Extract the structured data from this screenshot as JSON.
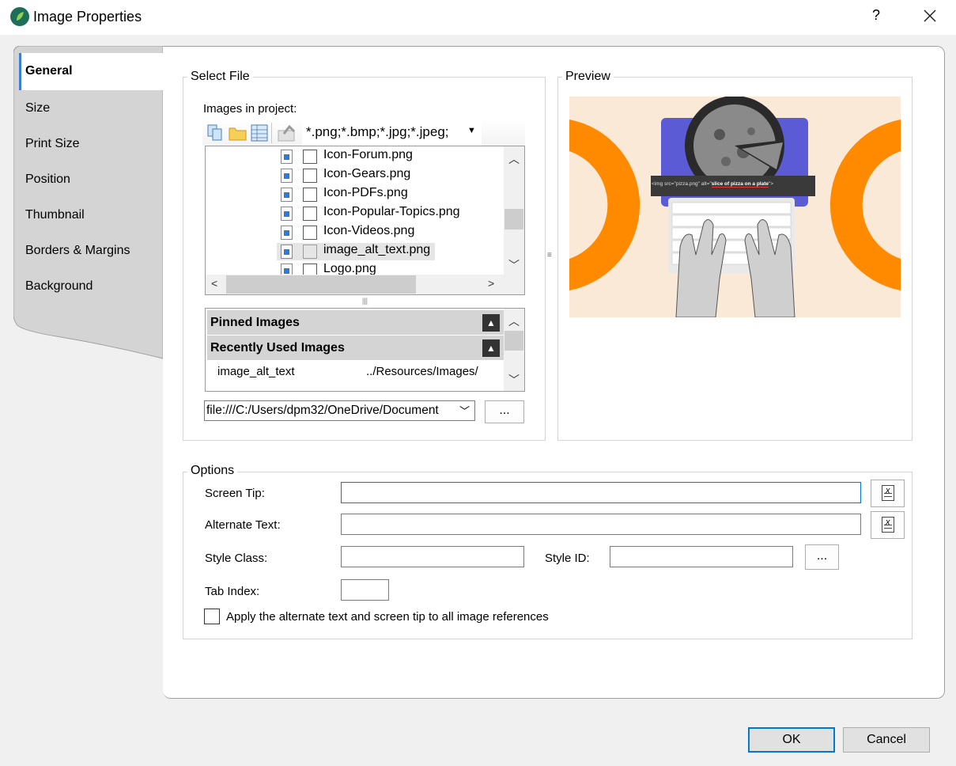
{
  "window": {
    "title": "Image Properties",
    "help": "?"
  },
  "tabs": [
    {
      "label": "General",
      "active": true
    },
    {
      "label": "Size"
    },
    {
      "label": "Print Size"
    },
    {
      "label": "Position"
    },
    {
      "label": "Thumbnail"
    },
    {
      "label": "Borders & Margins"
    },
    {
      "label": "Background"
    }
  ],
  "select_file": {
    "legend": "Select File",
    "images_label": "Images in project:",
    "filter": "*.png;*.bmp;*.jpg;*.jpeg;",
    "tree_items": [
      {
        "name": "Icon-Forum.png"
      },
      {
        "name": "Icon-Gears.png"
      },
      {
        "name": "Icon-PDFs.png"
      },
      {
        "name": "Icon-Popular-Topics.png"
      },
      {
        "name": "Icon-Videos.png"
      },
      {
        "name": "image_alt_text.png",
        "selected": true
      },
      {
        "name": "Logo.png"
      }
    ],
    "pinned_header": "Pinned Images",
    "recent_header": "Recently Used Images",
    "recent_items": [
      {
        "name": "image_alt_text",
        "path": "../Resources/Images/"
      }
    ],
    "path_value": "file:///C:/Users/dpm32/OneDrive/Document",
    "browse_label": "..."
  },
  "preview": {
    "legend": "Preview",
    "code_snippet": "<img src=\"pizza.png\" alt=\"",
    "alt_snippet": "slice of pizza on a plate",
    "code_end": "\">",
    "colors": {
      "background": "#fbe9d8",
      "accent": "#ff8a00",
      "screen": "#5b5bd6"
    }
  },
  "options": {
    "legend": "Options",
    "screen_tip_label": "Screen Tip:",
    "screen_tip_value": "",
    "alt_text_label": "Alternate Text:",
    "alt_text_value": "",
    "style_class_label": "Style Class:",
    "style_class_value": "",
    "style_id_label": "Style ID:",
    "style_id_value": "",
    "style_id_button": "...",
    "tab_index_label": "Tab Index:",
    "tab_index_value": "",
    "apply_all_label": "Apply the alternate text and screen tip to all image references",
    "apply_all_checked": false
  },
  "footer": {
    "ok": "OK",
    "cancel": "Cancel"
  }
}
